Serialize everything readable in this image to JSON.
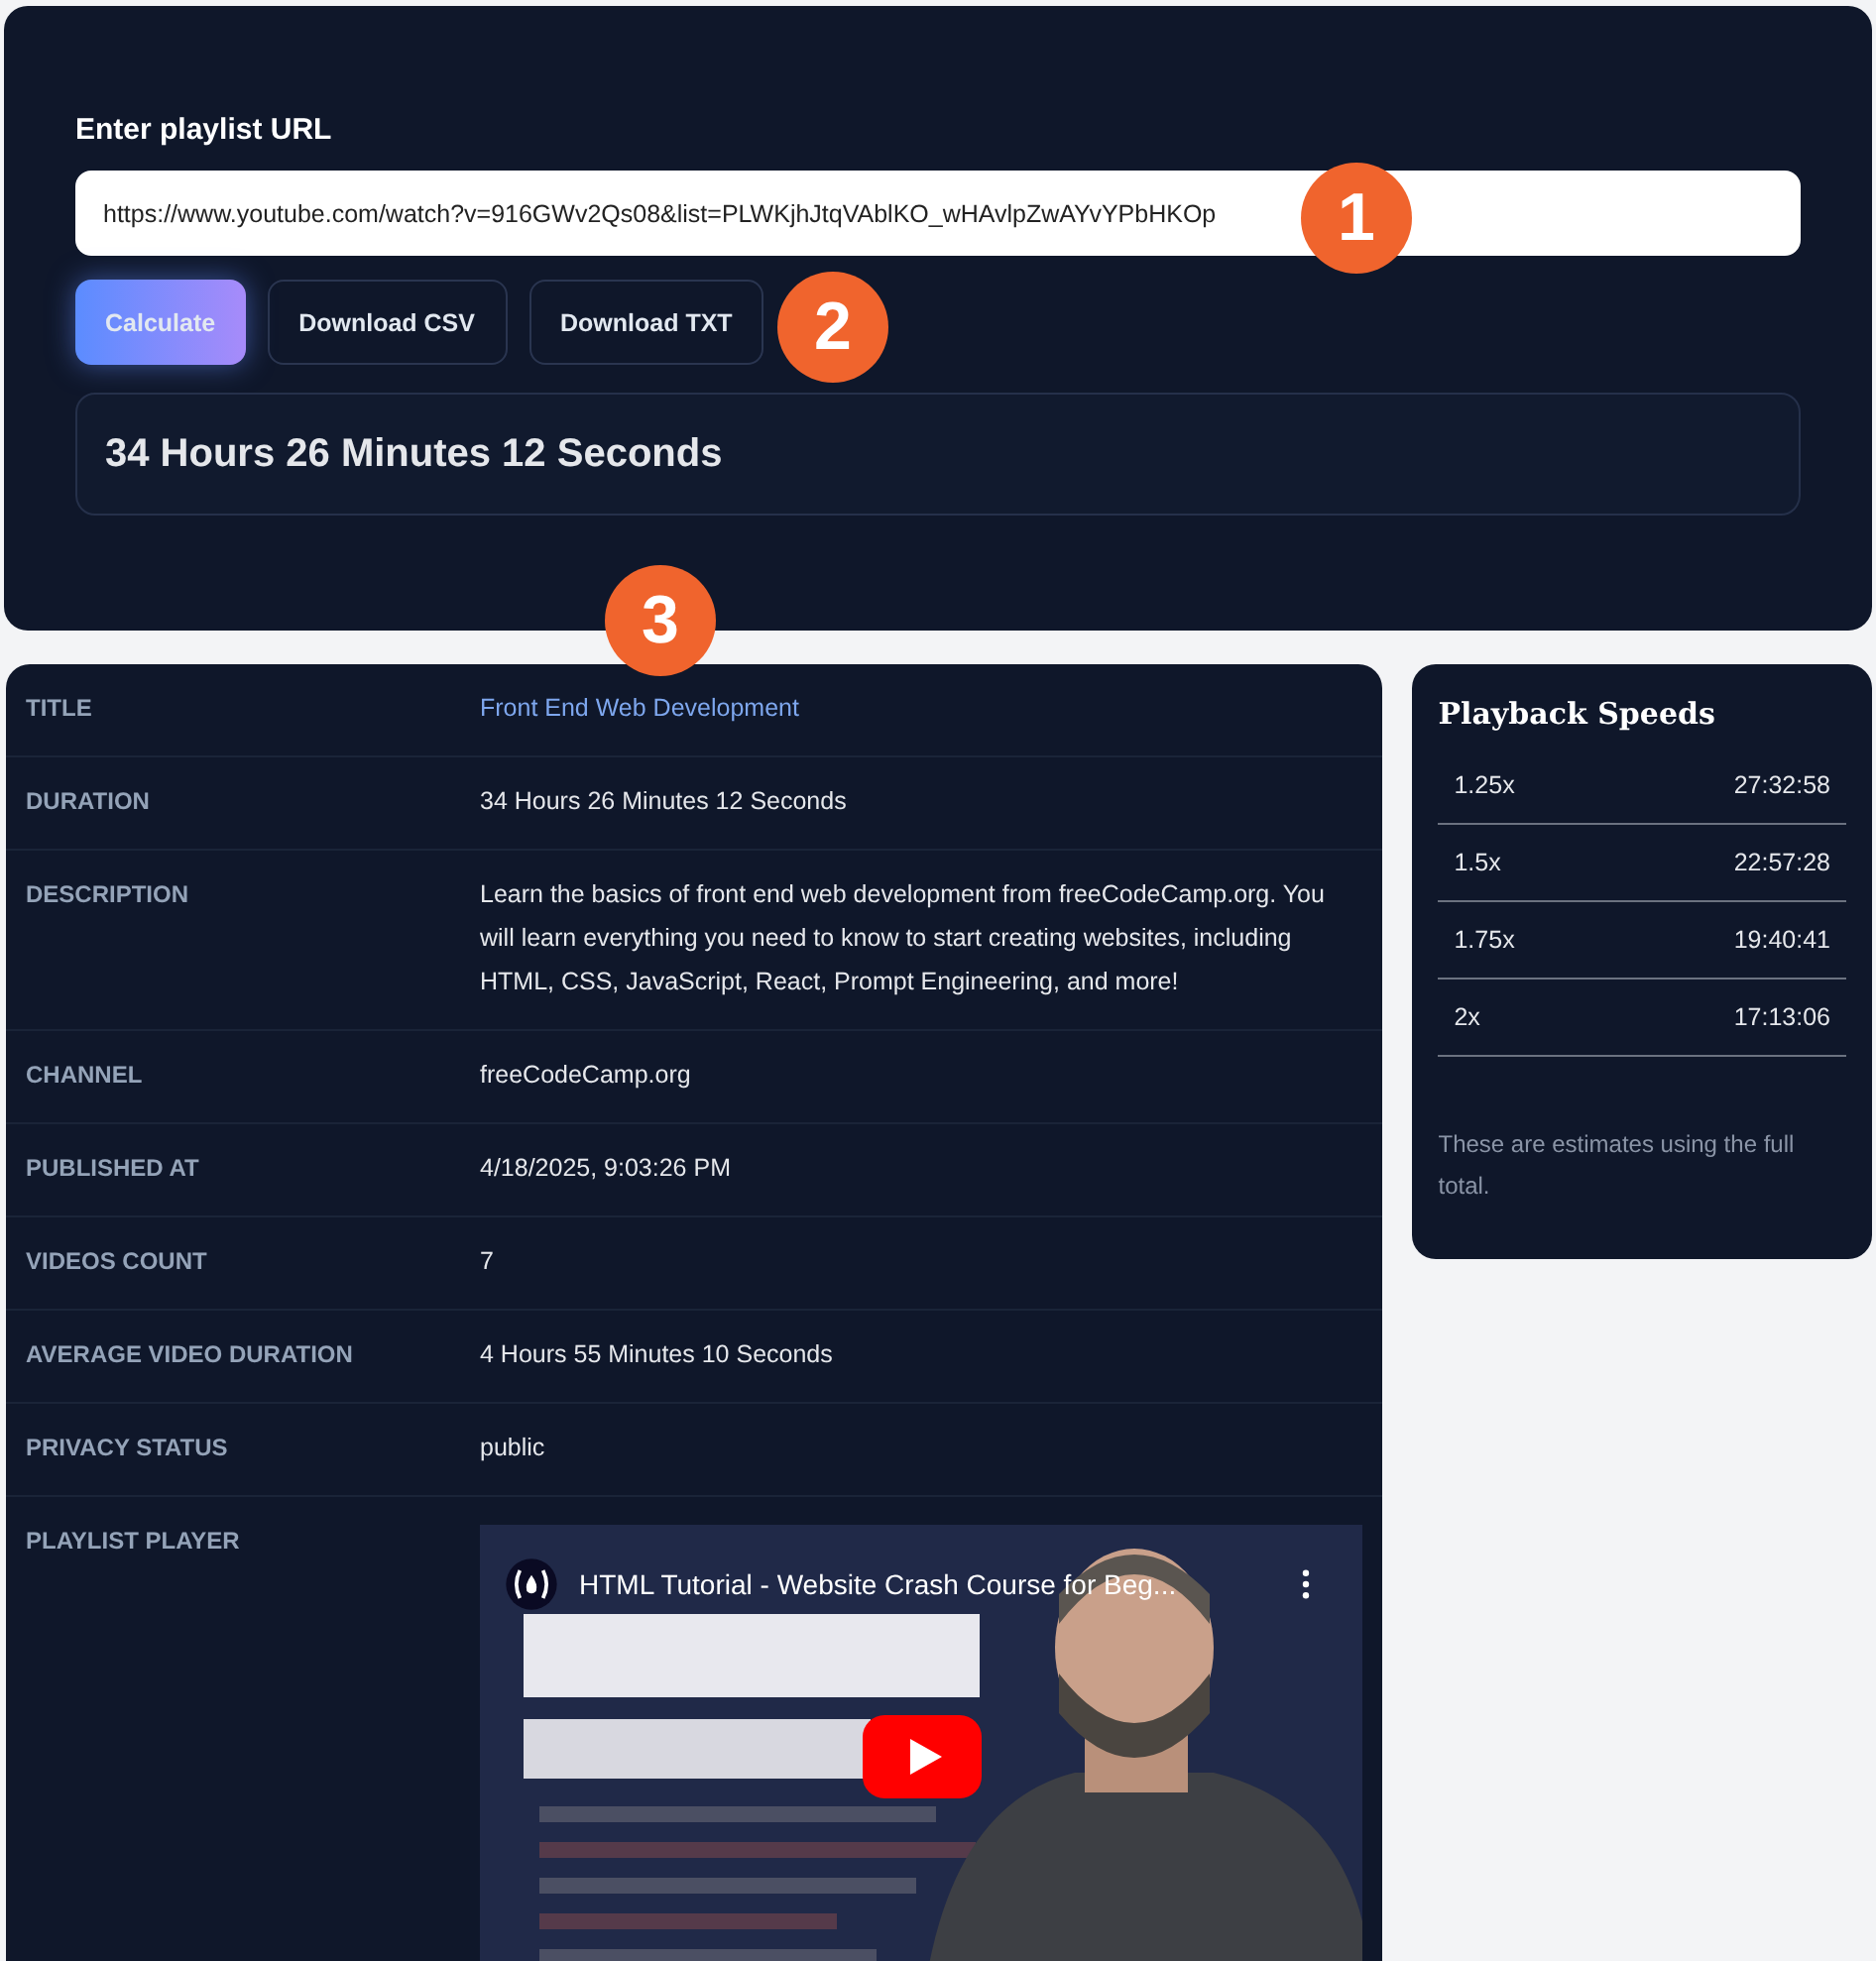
{
  "form": {
    "label": "Enter playlist URL",
    "url": "https://www.youtube.com/watch?v=916GWv2Qs08&list=PLWKjhJtqVAblKO_wHAvlpZwAYvYPbHKOp",
    "buttons": [
      {
        "label": "Calculate",
        "kind": "primary"
      },
      {
        "label": "Download CSV",
        "kind": "outline"
      },
      {
        "label": "Download TXT",
        "kind": "outline"
      }
    ],
    "result": "34 Hours 26 Minutes 12 Seconds"
  },
  "annotations": [
    "1",
    "2",
    "3"
  ],
  "details": [
    {
      "label": "TITLE",
      "value": "Front End Web Development",
      "kind": "link"
    },
    {
      "label": "DURATION",
      "value": "34 Hours 26 Minutes 12 Seconds",
      "kind": "text"
    },
    {
      "label": "DESCRIPTION",
      "value": "Learn the basics of front end web development from freeCodeCamp.org. You will learn everything you need to know to start creating websites, including HTML, CSS, JavaScript, React, Prompt Engineering, and more!",
      "kind": "text"
    },
    {
      "label": "CHANNEL",
      "value": "freeCodeCamp.org",
      "kind": "text"
    },
    {
      "label": "PUBLISHED AT",
      "value": "4/18/2025, 9:03:26 PM",
      "kind": "text"
    },
    {
      "label": "VIDEOS COUNT",
      "value": "7",
      "kind": "text"
    },
    {
      "label": "AVERAGE VIDEO DURATION",
      "value": "4 Hours 55 Minutes 10 Seconds",
      "kind": "text"
    },
    {
      "label": "PRIVACY STATUS",
      "value": "public",
      "kind": "text"
    },
    {
      "label": "PLAYLIST PLAYER",
      "kind": "player",
      "video_title": "HTML Tutorial - Website Crash Course for Beg..."
    }
  ],
  "speeds": {
    "title": "Playback Speeds",
    "rows": [
      {
        "speed": "1.25x",
        "time": "27:32:58"
      },
      {
        "speed": "1.5x",
        "time": "22:57:28"
      },
      {
        "speed": "1.75x",
        "time": "19:40:41"
      },
      {
        "speed": "2x",
        "time": "17:13:06"
      }
    ],
    "note": "These are estimates using the full total."
  }
}
